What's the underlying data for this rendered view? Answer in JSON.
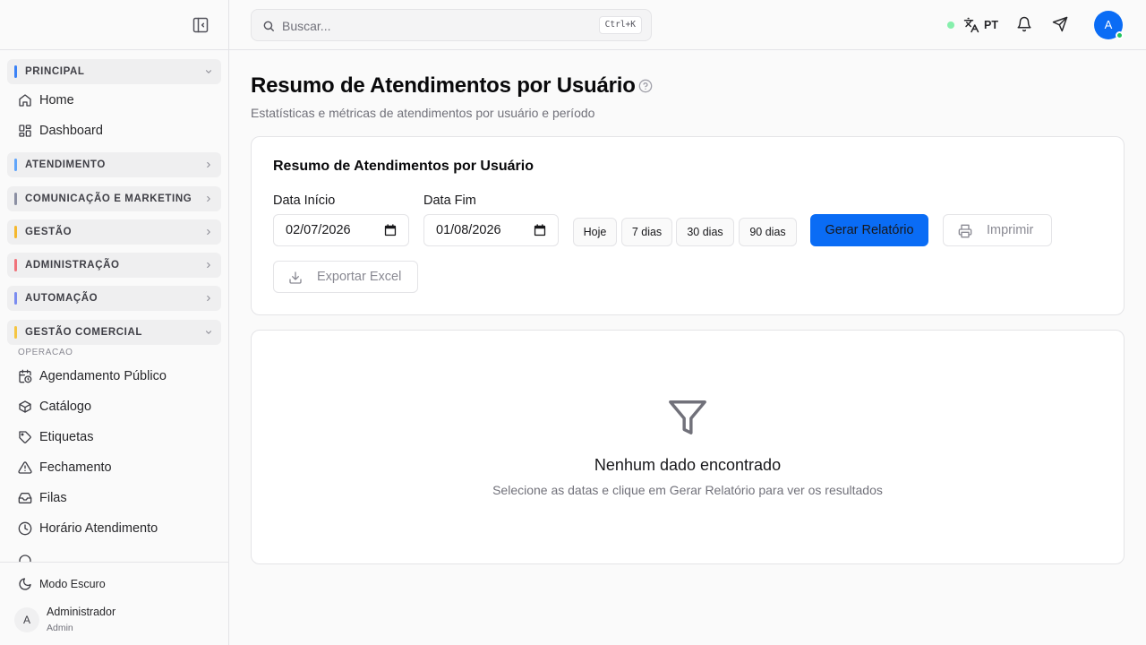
{
  "sidebar": {
    "groups": {
      "principal": {
        "label": "PRINCIPAL",
        "color": "#3b82f6"
      },
      "atendimento": {
        "label": "ATENDIMENTO",
        "color": "#60a5fa"
      },
      "comunicacao": {
        "label": "COMUNICAÇÃO E MARKETING",
        "color": "#8b8fa3"
      },
      "gestao": {
        "label": "GESTÃO",
        "color": "#f5b82e"
      },
      "administracao": {
        "label": "ADMINISTRAÇÃO",
        "color": "#f0727a"
      },
      "automacao": {
        "label": "AUTOMAÇÃO",
        "color": "#7b8cf0"
      },
      "gestao_comercial": {
        "label": "GESTÃO COMERCIAL",
        "color": "#f5c542"
      }
    },
    "principal_items": [
      {
        "label": "Home",
        "icon": "home-icon"
      },
      {
        "label": "Dashboard",
        "icon": "dashboard-icon"
      }
    ],
    "section_label": "OPERACAO",
    "comercial_items": [
      {
        "label": "Agendamento Público",
        "icon": "calendar-clock-icon"
      },
      {
        "label": "Catálogo",
        "icon": "package-icon"
      },
      {
        "label": "Etiquetas",
        "icon": "tag-icon"
      },
      {
        "label": "Fechamento",
        "icon": "warning-icon"
      },
      {
        "label": "Filas",
        "icon": "inbox-icon"
      },
      {
        "label": "Horário Atendimento",
        "icon": "clock-icon"
      }
    ],
    "dark_mode_label": "Modo Escuro",
    "user": {
      "initial": "A",
      "name": "Administrador",
      "role": "Admin"
    }
  },
  "header": {
    "search_placeholder": "Buscar...",
    "search_shortcut": "Ctrl+K",
    "language": "PT",
    "avatar_initial": "A",
    "status_color": "#86efac"
  },
  "page": {
    "title": "Resumo de Atendimentos por Usuário",
    "subtitle": "Estatísticas e métricas de atendimentos por usuário e período"
  },
  "filters": {
    "card_title": "Resumo de Atendimentos por Usuário",
    "start_label": "Data Início",
    "start_value": "02/07/2026",
    "end_label": "Data Fim",
    "end_value": "01/08/2026",
    "presets": [
      "Hoje",
      "7 dias",
      "30 dias",
      "90 dias"
    ],
    "generate_label": "Gerar Relatório",
    "print_label": "Imprimir",
    "export_label": "Exportar Excel",
    "accent_color": "#0a6cf5"
  },
  "empty": {
    "title": "Nenhum dado encontrado",
    "subtitle": "Selecione as datas e clique em Gerar Relatório para ver os resultados"
  }
}
